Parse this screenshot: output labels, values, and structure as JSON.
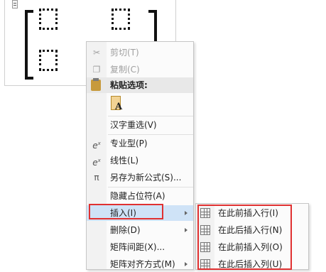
{
  "equation": {
    "placeholders": 4
  },
  "context_menu": {
    "items": [
      {
        "label": "剪切(T)",
        "icon": "scissors-icon",
        "disabled": true
      },
      {
        "label": "复制(C)",
        "icon": "copy-icon",
        "disabled": true
      },
      {
        "label": "粘贴选项:",
        "icon": "clipboard-icon",
        "header": true
      },
      {
        "label": "A",
        "icon": "paste-keep-text-icon"
      },
      {
        "label": "汉字重选(V)",
        "icon": ""
      },
      {
        "label": "专业型(P)",
        "icon": "professional-format-icon"
      },
      {
        "label": "线性(L)",
        "icon": "linear-format-icon"
      },
      {
        "label": "另存为新公式(S)...",
        "icon": "save-equation-icon"
      },
      {
        "label": "隐藏占位符(A)",
        "icon": ""
      },
      {
        "label": "插入(I)",
        "icon": "",
        "submenu": true,
        "highlighted": true
      },
      {
        "label": "删除(D)",
        "icon": "",
        "submenu": true
      },
      {
        "label": "矩阵间距(X)...",
        "icon": ""
      },
      {
        "label": "矩阵对齐方式(M)",
        "icon": "",
        "submenu": true
      }
    ]
  },
  "insert_submenu": {
    "items": [
      {
        "label": "在此前插入行(I)",
        "icon": "insert-row-above-icon"
      },
      {
        "label": "在此后插入行(N)",
        "icon": "insert-row-below-icon"
      },
      {
        "label": "在此前插入列(O)",
        "icon": "insert-column-left-icon"
      },
      {
        "label": "在此后插入列(U)",
        "icon": "insert-column-right-icon"
      }
    ]
  },
  "colors": {
    "highlight": "#cfe3f7",
    "annotation_red": "#e03131"
  }
}
